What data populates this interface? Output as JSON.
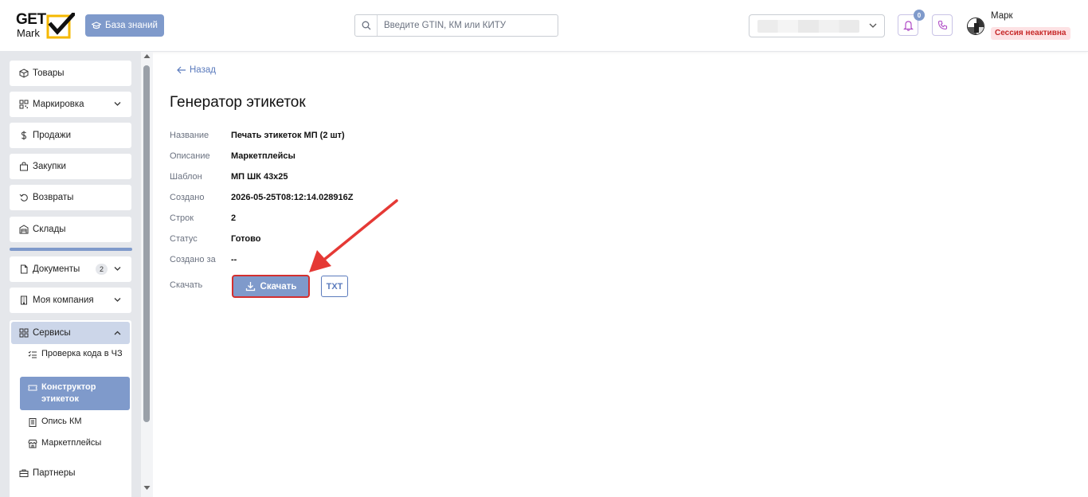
{
  "header": {
    "logo_get": "GET",
    "logo_mark": "Mark",
    "kb_label": "База знаний",
    "search_placeholder": "Введите GTIN, КМ или КИТУ",
    "notif_count": "0",
    "user_name": "Марк",
    "session_status": "Сессия неактивна"
  },
  "sidebar": {
    "items": [
      {
        "label": "Товары",
        "icon": "box-icon"
      },
      {
        "label": "Маркировка",
        "icon": "qr-icon"
      },
      {
        "label": "Продажи",
        "icon": "dollar-icon"
      },
      {
        "label": "Закупки",
        "icon": "bag-icon"
      },
      {
        "label": "Возвраты",
        "icon": "return-icon"
      },
      {
        "label": "Склады",
        "icon": "warehouse-icon"
      },
      {
        "label": "Документы",
        "icon": "document-icon",
        "count": "2"
      },
      {
        "label": "Моя компания",
        "icon": "building-icon"
      }
    ],
    "services": {
      "label": "Сервисы",
      "sub": [
        {
          "label": "Проверка кода в ЧЗ"
        },
        {
          "label": "Конструктор этикеток"
        },
        {
          "label": "Опись КМ"
        },
        {
          "label": "Маркетплейсы"
        }
      ]
    },
    "partners": "Партнеры"
  },
  "main": {
    "back": "Назад",
    "title": "Генератор этикеток",
    "fields": [
      {
        "label": "Название",
        "value": "Печать этикеток МП (2 шт)"
      },
      {
        "label": "Описание",
        "value": "Маркетплейсы"
      },
      {
        "label": "Шаблон",
        "value": "МП ШК 43x25"
      },
      {
        "label": "Создано",
        "value": "2026-05-25T08:12:14.028916Z"
      },
      {
        "label": "Строк",
        "value": "2"
      },
      {
        "label": "Статус",
        "value": "Готово"
      },
      {
        "label": "Создано за",
        "value": "--"
      }
    ],
    "download_label": "Скачать",
    "download_button": "Скачать",
    "txt_button": "TXT"
  },
  "colors": {
    "accent": "#7f9acb",
    "link": "#5b7bbd",
    "highlight": "#d32f2f"
  }
}
